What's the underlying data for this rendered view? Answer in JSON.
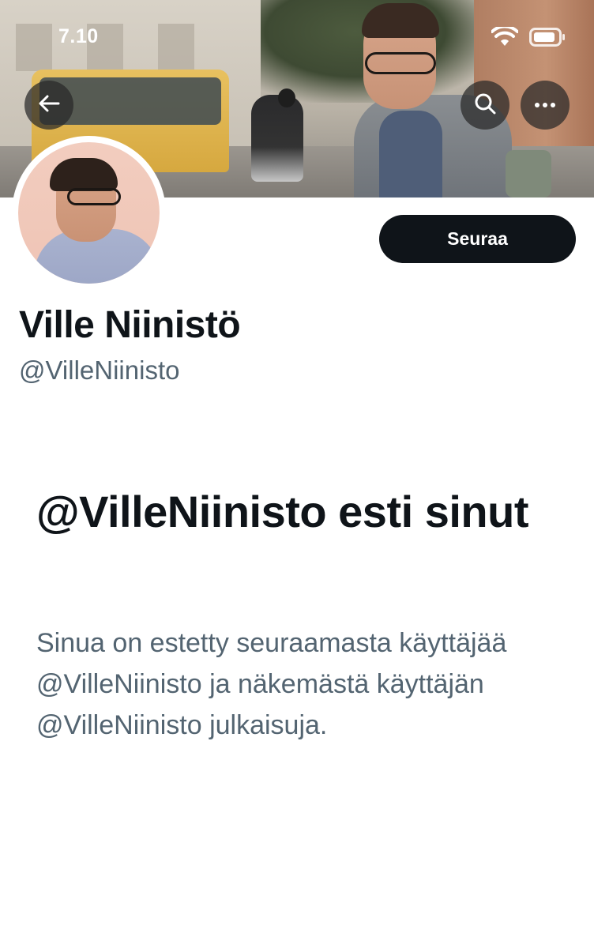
{
  "status_bar": {
    "time": "7.10",
    "wifi_icon": "wifi-icon",
    "battery_icon": "battery-icon"
  },
  "header": {
    "back_icon": "arrow-left-icon",
    "search_icon": "search-icon",
    "more_icon": "more-horizontal-icon"
  },
  "profile": {
    "display_name": "Ville Niinistö",
    "handle": "@VilleNiinisto",
    "follow_label": "Seuraa"
  },
  "blocked_notice": {
    "title": "@VilleNiinisto esti sinut",
    "description": "Sinua on estetty seuraamasta käyttäjää @VilleNiinisto ja näkemästä käyttäjän @VilleNiinisto julkaisuja."
  },
  "colors": {
    "primary_text": "#0f1419",
    "secondary_text": "#536471",
    "button_bg": "#0f1419",
    "background": "#ffffff"
  }
}
